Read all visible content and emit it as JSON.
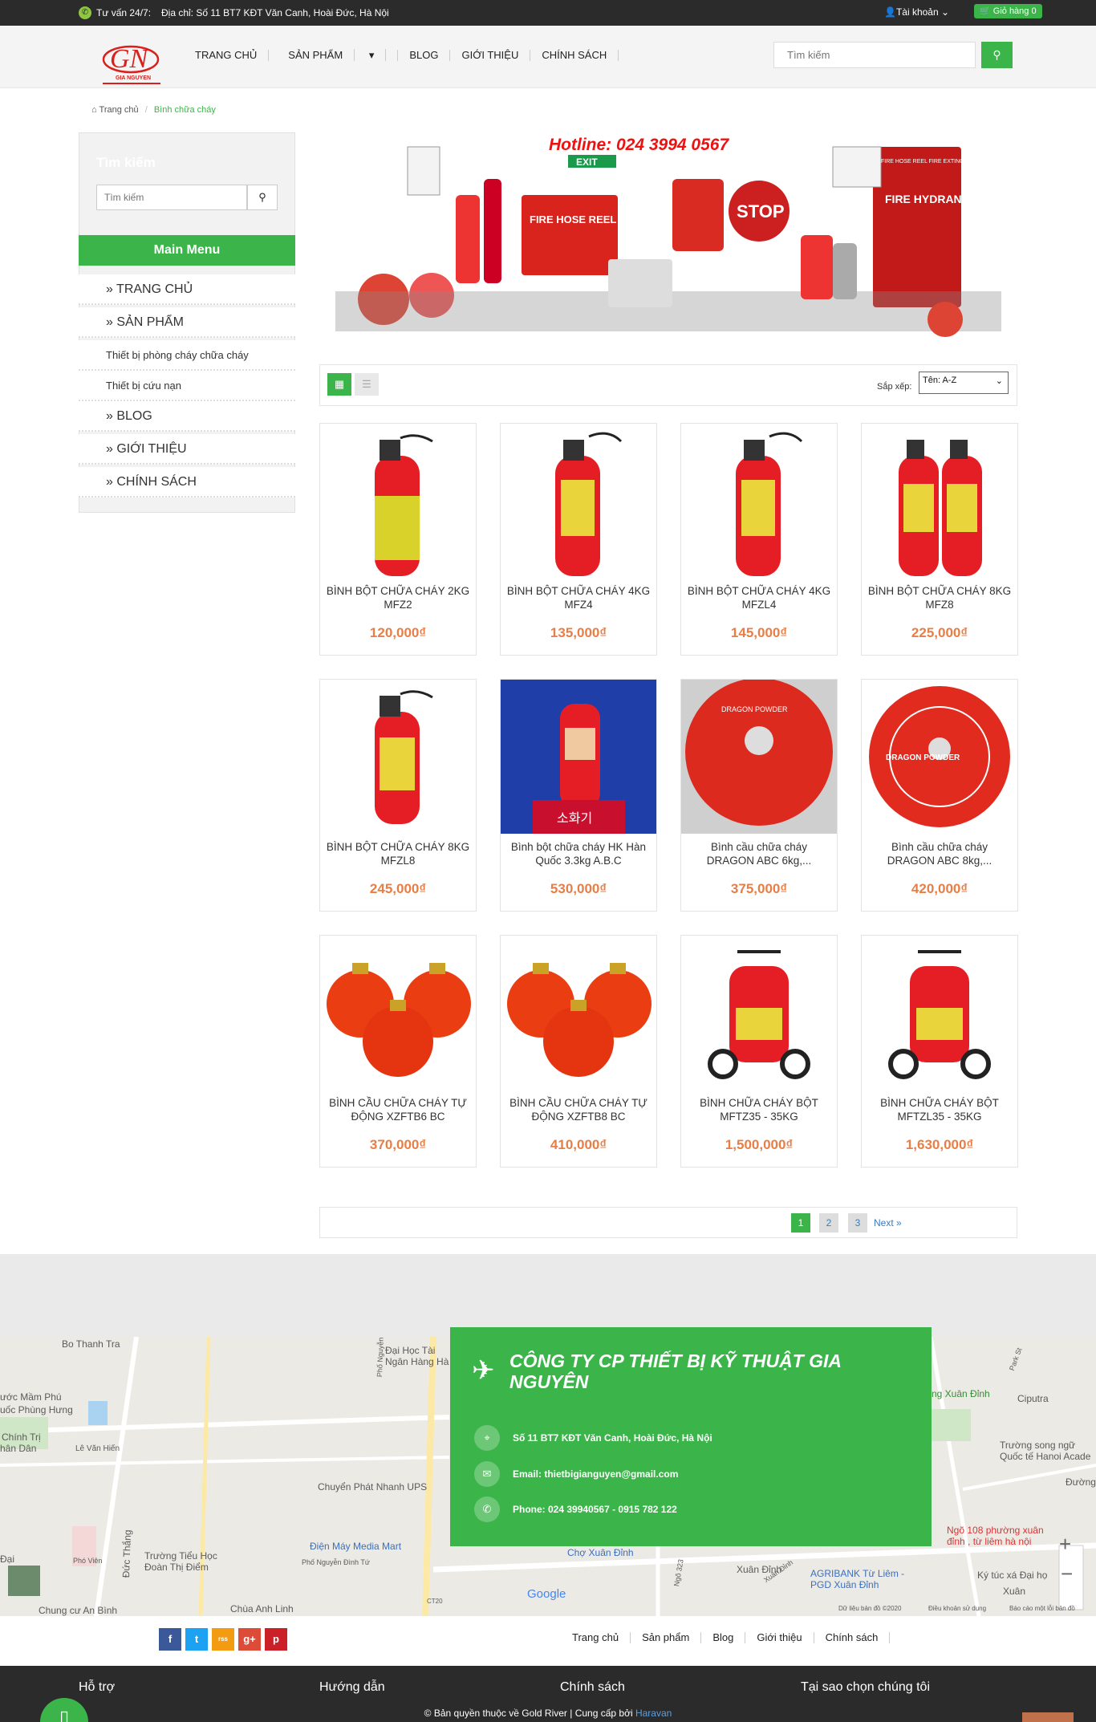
{
  "topbar": {
    "hotline_label": "Tư vấn 24/7:",
    "address": "Địa chỉ: Số 11 BT7 KĐT Văn Canh, Hoài Đức, Hà Nội",
    "account": "Tài khoản",
    "cart": "Giỏ hàng 0"
  },
  "header": {
    "logo_text": "GN",
    "logo_sub": "GIA NGUYEN",
    "nav": [
      "TRANG CHỦ",
      "SẢN PHẨM",
      "BLOG",
      "GIỚI THIỆU",
      "CHÍNH SÁCH"
    ],
    "search_placeholder": "Tìm kiếm"
  },
  "breadcrumb": {
    "home": "Trang chủ",
    "sep": "/",
    "current": "Bình chữa cháy"
  },
  "sidebar": {
    "search_title": "Tìm kiếm",
    "search_placeholder": "Tìm kiếm",
    "menu_title": "Main Menu",
    "items": [
      "» TRANG CHỦ",
      "» SẢN PHẨM",
      "Thiết bị phòng cháy chữa cháy",
      "Thiết bị cứu nạn",
      "» BLOG",
      "» GIỚI THIỆU",
      "» CHÍNH SÁCH"
    ]
  },
  "banner": {
    "hotline": "Hotline: 024 3994 0567",
    "exit": "EXIT",
    "fire_hose": "FIRE HOSE REEL",
    "stop": "STOP",
    "hydrant": "FIRE HYDRANT HOSE",
    "hose_reel_label": "FIRE HOSE REEL FIRE EXTINGUISHER"
  },
  "toolbar": {
    "sort_label": "Sắp xếp:",
    "sort_value": "Tên: A-Z"
  },
  "products": [
    {
      "name": "BÌNH BỘT CHỮA CHÁY 2KG MFZ2",
      "price": "120,000₫"
    },
    {
      "name": "BÌNH BỘT CHỮA CHÁY 4KG MFZ4",
      "price": "135,000₫"
    },
    {
      "name": "BÌNH BỘT CHỮA CHÁY 4KG MFZL4",
      "price": "145,000₫"
    },
    {
      "name": "BÌNH BỘT CHỮA CHÁY 8KG MFZ8",
      "price": "225,000₫"
    },
    {
      "name": "BÌNH BỘT CHỮA CHÁY 8KG MFZL8",
      "price": "245,000₫"
    },
    {
      "name": "Bình bột chữa cháy HK Hàn Quốc 3.3kg A.B.C",
      "price": "530,000₫"
    },
    {
      "name": "Bình cầu chữa cháy DRAGON ABC 6kg,...",
      "price": "375,000₫"
    },
    {
      "name": "Bình cầu chữa cháy DRAGON ABC 8kg,...",
      "price": "420,000₫"
    },
    {
      "name": "BÌNH CẦU CHỮA CHÁY TỰ ĐỘNG XZFTB6 BC",
      "price": "370,000₫"
    },
    {
      "name": "BÌNH CẦU CHỮA CHÁY TỰ ĐỘNG XZFTB8 BC",
      "price": "410,000₫"
    },
    {
      "name": "BÌNH CHỮA CHÁY BỘT MFTZ35 - 35KG",
      "price": "1,500,000₫"
    },
    {
      "name": "BÌNH CHỮA CHÁY BỘT MFTZL35 - 35KG",
      "price": "1,630,000₫"
    }
  ],
  "product_labels": {
    "korean": "소화기",
    "dragon": "DRAGON POWDER"
  },
  "pagination": {
    "pages": [
      "1",
      "2",
      "3"
    ],
    "next": "Next »"
  },
  "map": {
    "labels": [
      "Bo Thanh Tra",
      "Đại Học Tài Ngân Hàng Hà",
      "ước Mầm Phú",
      "uốc Phùng Hưng",
      "Chính Trị",
      "hân Dân",
      "Lê Văn Hiến",
      "Phố Nguyễn Đình Tứ",
      "Chuyển Phát Nhanh UPS",
      "Đức Thắng",
      "Phó Viên",
      "Trường Tiểu Học Đoàn Thị Điểm",
      "Điện Máy Media Mart",
      "Phố Nguyễn Đình Tứ",
      "Chợ Xuân Đỉnh",
      "Chùa Anh Linh",
      "Chung cư An Bình",
      "Xuân Đỉnh",
      "AGRIBANK Từ Liêm - PGD Xuân Đỉnh",
      "ng Xuân Đỉnh",
      "Ciputra",
      "Trường song ngữ Quốc tế Hanoi Acade",
      "Ngõ 108 phường xuân đỉnh , từ liêm hà nội",
      "Ký túc xá Đại họ",
      "Xuân",
      "Đường",
      "CT20",
      "Google",
      "Park St",
      "Dữ liệu bản đồ ©2020",
      "Điều khoản sử dụng",
      "Báo cáo một lỗi bản đồ",
      "Ngõ 323",
      "Xuân Đỉnh",
      "Đại"
    ],
    "zoom_in": "+",
    "zoom_out": "−"
  },
  "company": {
    "name": "CÔNG TY CP THIẾT BỊ KỸ THUẬT GIA NGUYÊN",
    "address": "Số 11 BT7 KĐT Văn Canh, Hoài Đức, Hà Nội",
    "email": "Email: thietbigianguyen@gmail.com",
    "phone": "Phone: 024 39940567 - 0915 782 122"
  },
  "social": [
    "f",
    "t",
    "rss",
    "g+",
    "p"
  ],
  "footer_nav": [
    "Trang chủ",
    "Sản phẩm",
    "Blog",
    "Giới thiệu",
    "Chính sách"
  ],
  "footer": {
    "headings": [
      "Hỗ trợ",
      "Hướng dẫn",
      "Chính sách",
      "Tại sao chọn chúng tôi"
    ],
    "copyright": "© Bản quyền thuộc về Gold River | Cung cấp bởi",
    "provider": "Haravan"
  },
  "colors": {
    "brand_green": "#3bb54a",
    "price_orange": "#e67e46",
    "dark": "#2b2b2b",
    "logo_red": "#d9201c"
  }
}
